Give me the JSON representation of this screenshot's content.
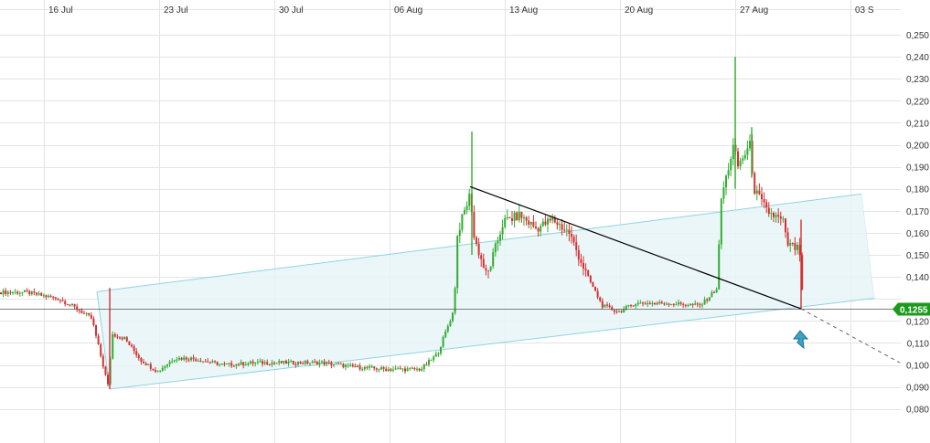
{
  "chart_data": {
    "type": "candlestick",
    "x_tick_labels": [
      "16 Jul",
      "23 Jul",
      "30 Jul",
      "06 Aug",
      "13 Aug",
      "20 Aug",
      "27 Aug",
      "03 S"
    ],
    "y_tick_labels": [
      "0,250",
      "0,240",
      "0,230",
      "0,220",
      "0,210",
      "0,200",
      "0,190",
      "0,180",
      "0,170",
      "0,160",
      "0,150",
      "0,140",
      "0,120",
      "0,110",
      "0,100",
      "0,090",
      "0,080"
    ],
    "ylim": [
      0.075,
      0.265
    ],
    "grid": true,
    "current_price": 0.1255,
    "current_price_label": "0,1255",
    "colors": {
      "up": "#2fae2f",
      "down": "#d23131",
      "channel_line": "#8fd3e3",
      "channel_fill": "#e8f5f8",
      "trendline": "#000000",
      "price_tag": "#1b9a1b",
      "arrow": "#3aa3c8"
    },
    "price_path": [
      [
        "15 Jul",
        0.133
      ],
      [
        "17 Jul",
        0.13
      ],
      [
        "18 Jul",
        0.126
      ],
      [
        "19 Jul",
        0.121
      ],
      [
        "20 Jul",
        0.09
      ],
      [
        "20 Jul",
        0.114
      ],
      [
        "21 Jul",
        0.112
      ],
      [
        "22 Jul",
        0.102
      ],
      [
        "23 Jul",
        0.097
      ],
      [
        "24 Jul",
        0.103
      ],
      [
        "25 Jul",
        0.103
      ],
      [
        "27 Jul",
        0.1
      ],
      [
        "29 Jul",
        0.101
      ],
      [
        "31 Jul",
        0.101
      ],
      [
        "02 Aug",
        0.101
      ],
      [
        "04 Aug",
        0.099
      ],
      [
        "06 Aug",
        0.098
      ],
      [
        "08 Aug",
        0.098
      ],
      [
        "09 Aug",
        0.105
      ],
      [
        "10 Aug",
        0.125
      ],
      [
        "10 Aug",
        0.16
      ],
      [
        "11 Aug",
        0.178
      ],
      [
        "11 Aug",
        0.158
      ],
      [
        "12 Aug",
        0.14
      ],
      [
        "13 Aug",
        0.165
      ],
      [
        "14 Aug",
        0.168
      ],
      [
        "15 Aug",
        0.162
      ],
      [
        "16 Aug",
        0.166
      ],
      [
        "17 Aug",
        0.16
      ],
      [
        "18 Aug",
        0.142
      ],
      [
        "19 Aug",
        0.127
      ],
      [
        "20 Aug",
        0.124
      ],
      [
        "21 Aug",
        0.128
      ],
      [
        "23 Aug",
        0.128
      ],
      [
        "25 Aug",
        0.127
      ],
      [
        "26 Aug",
        0.135
      ],
      [
        "26 Aug",
        0.175
      ],
      [
        "27 Aug",
        0.2
      ],
      [
        "27 Aug",
        0.19
      ],
      [
        "28 Aug",
        0.2
      ],
      [
        "28 Aug",
        0.18
      ],
      [
        "29 Aug",
        0.17
      ],
      [
        "30 Aug",
        0.165
      ],
      [
        "30 Aug",
        0.155
      ],
      [
        "31 Aug",
        0.152
      ],
      [
        "31 Aug",
        0.1255
      ]
    ],
    "spikes": [
      {
        "date": "20 Jul",
        "high": 0.135,
        "low": 0.089
      },
      {
        "date": "11 Aug",
        "high": 0.206,
        "low": 0.15
      },
      {
        "date": "27 Aug",
        "high": 0.24,
        "low": 0.18
      },
      {
        "date": "28 Aug",
        "high": 0.208,
        "low": 0.185
      },
      {
        "date": "31 Aug",
        "high": 0.166,
        "low": 0.1255
      }
    ],
    "channel": {
      "upper": [
        [
          "20 Jul",
          0.134
        ],
        [
          "03 Sep",
          0.177
        ]
      ],
      "lower": [
        [
          "20 Jul",
          0.089
        ],
        [
          "03 Sep",
          0.129
        ]
      ]
    },
    "trendline": [
      [
        "11 Aug",
        0.181
      ],
      [
        "31 Aug",
        0.1255
      ]
    ],
    "trendline_projection": [
      [
        "31 Aug",
        0.1255
      ],
      [
        "06 Sep",
        0.101
      ]
    ]
  }
}
